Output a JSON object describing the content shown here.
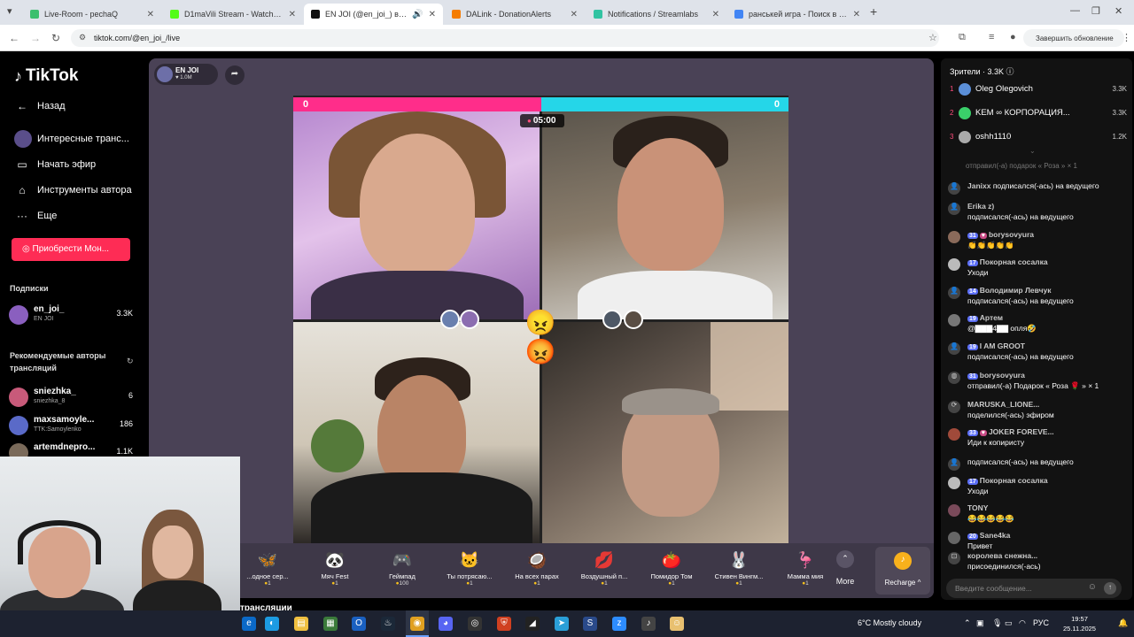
{
  "browser": {
    "tabs": [
      {
        "label": "Live-Room - pechaQ",
        "color": "#3cbf6e"
      },
      {
        "label": "D1maVili Stream - Watch Live c",
        "color": "#53fc18"
      },
      {
        "label": "EN JOI (@en_joi_) в эфире",
        "color": "#111111"
      },
      {
        "label": "DALink - DonationAlerts",
        "color": "#f57c00"
      },
      {
        "label": "Notifications / Streamlabs",
        "color": "#31c3a2"
      },
      {
        "label": "ранськей игра - Поиск в Goo",
        "color": "#4285f4"
      }
    ],
    "new_tab": "+",
    "url": "tiktok.com/@en_joi_/live",
    "update_button": "Завершить обновление",
    "menu": "⋮"
  },
  "sidebar": {
    "logo": "TikTok",
    "back": "Назад",
    "interesting": "Интересные транс...",
    "start_live": "Начать эфир",
    "author_tools": "Инструменты автора",
    "more": "Еще",
    "buy_button": "Приобрести Мон...",
    "subscriptions_title": "Подписки",
    "subscriptions": [
      {
        "name": "en_joi_",
        "sub": "EN JOI",
        "count": "3.3K",
        "color": "#8a5fbf"
      }
    ],
    "recommended_title": "Рекомендуемые авторы трансляций",
    "recommended": [
      {
        "name": "sniezhka_",
        "sub": "sniezhka_8",
        "count": "6",
        "color": "#c85a7a"
      },
      {
        "name": "maxsamoyle...",
        "sub": "TTK:Samoylenko",
        "count": "186",
        "color": "#5a6ac8"
      },
      {
        "name": "artemdnepro...",
        "sub": "",
        "count": "1.1K",
        "color": "#7a6a5a"
      }
    ]
  },
  "stage": {
    "host_name": "EN JOI",
    "host_likes": "♥ 1.0M",
    "score_left": "0",
    "score_right": "0",
    "score_left_fraction": 0.5,
    "timer": "05:00",
    "vs_emoji": "😠😡",
    "bottom_caption": "трансляции"
  },
  "gifts": [
    {
      "icon": "🦋",
      "name": "...одное сер...",
      "price": "1"
    },
    {
      "icon": "🐼",
      "name": "Мяч Fest",
      "price": "1"
    },
    {
      "icon": "🎮",
      "name": "Геймпад",
      "price": "100"
    },
    {
      "icon": "🐱",
      "name": "Ты потрясаю...",
      "price": "1"
    },
    {
      "icon": "🥥",
      "name": "На всех парах",
      "price": "1"
    },
    {
      "icon": "💋",
      "name": "Воздушный п...",
      "price": "1"
    },
    {
      "icon": "🍅",
      "name": "Помидор Том",
      "price": "1"
    },
    {
      "icon": "🐰",
      "name": "Стивен Вингм...",
      "price": "1"
    },
    {
      "icon": "🦩",
      "name": "Мамма мия",
      "price": "1"
    }
  ],
  "more_label": "More",
  "recharge_label": "Recharge ^",
  "chat": {
    "viewers_title": "Зрители · 3.3K ⓘ",
    "top": [
      {
        "rank": "1",
        "name": "Oleg Olegovich",
        "value": "3.3K",
        "color": "#5b8fd8"
      },
      {
        "rank": "2",
        "name": "KEM ∞ КОРПОРАЦИЯ...",
        "value": "3.3K",
        "color": "#3ad06a"
      },
      {
        "rank": "3",
        "name": "oshh1110",
        "value": "1.2K",
        "color": "#aaaaaa"
      }
    ],
    "cut_message": "отправил(-а) подарок « Роза » × 1",
    "messages": [
      {
        "level": "",
        "user": "Janixx",
        "line1_action": " подписался(-ась) на ведущего",
        "line2": ""
      },
      {
        "level": "",
        "user": "Erika z)",
        "line1_action": "",
        "line2": "подписался(-ась) на ведущего"
      },
      {
        "level": "31",
        "user": "borysovyura",
        "line1_action": "",
        "line2": "👏👏👏👏👏"
      },
      {
        "level": "17",
        "user": "Покорная сосалка",
        "line1_action": "",
        "line2": "Уходи"
      },
      {
        "level": "14",
        "user": "Володимир Левчук",
        "line1_action": "",
        "line2": "подписался(-ась) на ведущего"
      },
      {
        "level": "19",
        "user": "Артем",
        "line1_action": "",
        "line2": "@▇▇▇4▇▇ опля🤣"
      },
      {
        "level": "19",
        "user": "I AM GROOT",
        "line1_action": "",
        "line2": "подписался(-ась) на ведущего"
      },
      {
        "level": "31",
        "user": "borysovyura",
        "line1_action": "",
        "line2": "отправил(-а) Подарок « Роза 🌹 » × 1"
      },
      {
        "level": "",
        "user": "MARUSKA_LIONE...",
        "line1_action": "",
        "line2": "поделился(-ась) эфиром"
      },
      {
        "level": "33",
        "user": "JOKER FOREVE...",
        "line1_action": "",
        "line2": "Иди к копиристу"
      },
      {
        "level": "",
        "user": "",
        "line1_action": "подписался(-ась) на ведущего",
        "line2": ""
      },
      {
        "level": "17",
        "user": "Покорная сосалка",
        "line1_action": "",
        "line2": "Уходи"
      },
      {
        "level": "",
        "user": "TONY",
        "line1_action": "",
        "line2": "😂😂😂😂😂"
      },
      {
        "level": "20",
        "user": "Sane4ka",
        "line1_action": "",
        "line2": "Привет"
      },
      {
        "level": "",
        "user": "королева снежна...",
        "line1_action": "",
        "line2": "присоединился(-ась)"
      }
    ],
    "input_placeholder": "Введите сообщение..."
  },
  "taskbar": {
    "weather": "6°C  Mostly cloudy",
    "lang": "РУС",
    "time": "19:57",
    "date": "25.11.2025"
  }
}
